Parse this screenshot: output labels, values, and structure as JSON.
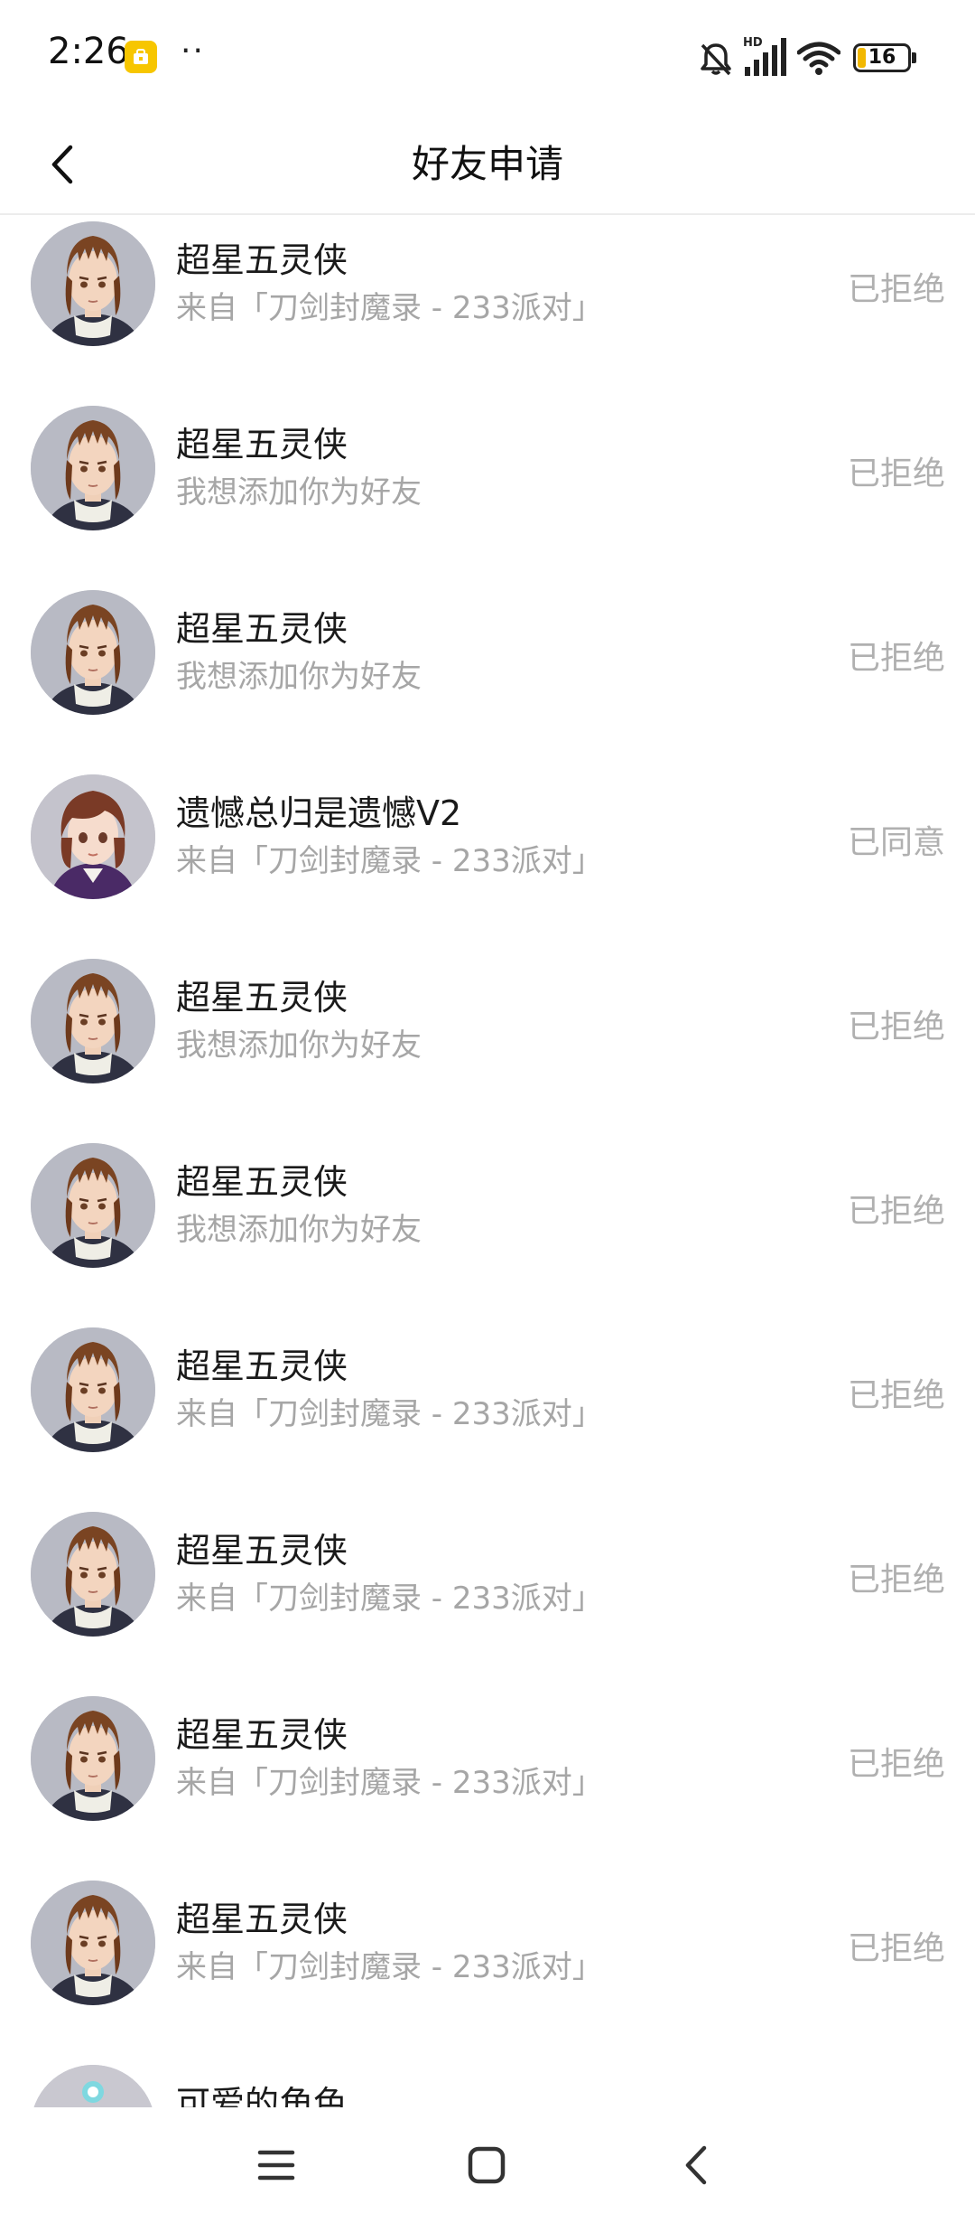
{
  "status_bar": {
    "time": "2:26",
    "dots": "··",
    "battery": "16",
    "battery_level_percent": 16,
    "signal_label": "HD"
  },
  "header": {
    "title": "好友申请"
  },
  "requests": [
    {
      "name": "超星五灵侠",
      "message": "来自「刀剑封魔录 - 233派对」",
      "status": "已拒绝",
      "avatar": "male-character"
    },
    {
      "name": "超星五灵侠",
      "message": "我想添加你为好友",
      "status": "已拒绝",
      "avatar": "male-character"
    },
    {
      "name": "超星五灵侠",
      "message": "我想添加你为好友",
      "status": "已拒绝",
      "avatar": "male-character"
    },
    {
      "name": "遗憾总归是遗憾V2",
      "message": "来自「刀剑封魔录 - 233派对」",
      "status": "已同意",
      "avatar": "female-character"
    },
    {
      "name": "超星五灵侠",
      "message": "我想添加你为好友",
      "status": "已拒绝",
      "avatar": "male-character"
    },
    {
      "name": "超星五灵侠",
      "message": "我想添加你为好友",
      "status": "已拒绝",
      "avatar": "male-character"
    },
    {
      "name": "超星五灵侠",
      "message": "来自「刀剑封魔录 - 233派对」",
      "status": "已拒绝",
      "avatar": "male-character"
    },
    {
      "name": "超星五灵侠",
      "message": "来自「刀剑封魔录 - 233派对」",
      "status": "已拒绝",
      "avatar": "male-character"
    },
    {
      "name": "超星五灵侠",
      "message": "来自「刀剑封魔录 - 233派对」",
      "status": "已拒绝",
      "avatar": "male-character"
    },
    {
      "name": "超星五灵侠",
      "message": "来自「刀剑封魔录 - 233派对」",
      "status": "已拒绝",
      "avatar": "male-character"
    },
    {
      "name": "可爱的角色",
      "message": "",
      "status": "",
      "avatar": "pink-character"
    }
  ],
  "colors": {
    "accent_battery": "#f2b800",
    "status_text": "#b0b0b0",
    "message_text": "#a6a6a6"
  },
  "nav": {
    "menu_icon": "menu-icon",
    "home_icon": "home-icon",
    "back_icon": "back-icon"
  }
}
